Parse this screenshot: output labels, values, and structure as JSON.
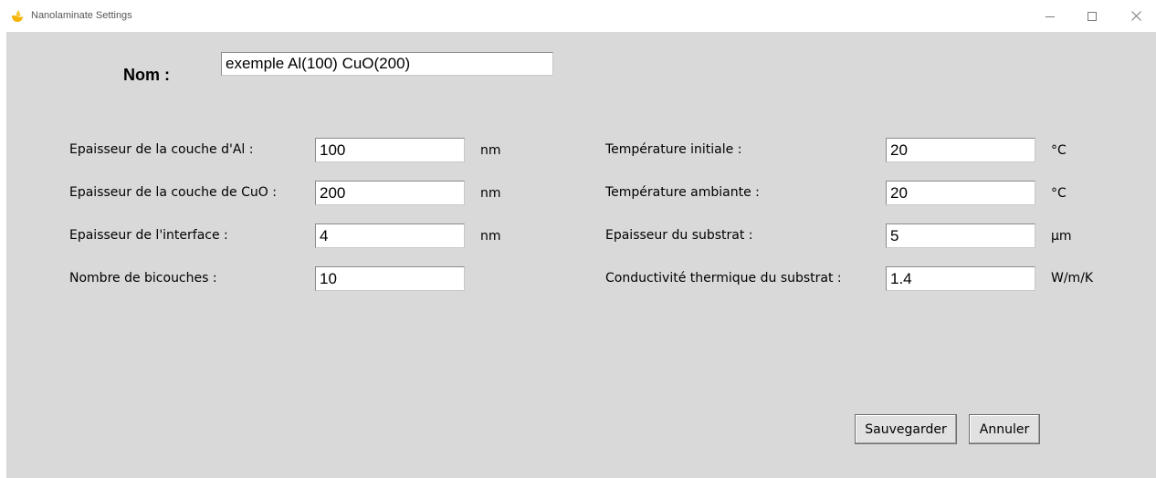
{
  "window": {
    "title": "Nanolaminate Settings",
    "icons": {
      "app": "flame-icon",
      "minimize": "minimize-icon",
      "maximize": "maximize-icon",
      "close": "close-icon"
    }
  },
  "name": {
    "label": "Nom :",
    "value": "exemple Al(100) CuO(200)"
  },
  "left_fields": [
    {
      "label": "Epaisseur de la couche d'Al :",
      "value": "100",
      "unit": "nm"
    },
    {
      "label": "Epaisseur de la couche de CuO :",
      "value": "200",
      "unit": "nm"
    },
    {
      "label": "Epaisseur de l'interface :",
      "value": "4",
      "unit": "nm"
    },
    {
      "label": "Nombre de bicouches :",
      "value": "10",
      "unit": ""
    }
  ],
  "right_fields": [
    {
      "label": "Température initiale :",
      "value": "20",
      "unit": "°C"
    },
    {
      "label": "Température ambiante :",
      "value": "20",
      "unit": "°C"
    },
    {
      "label": "Epaisseur du substrat :",
      "value": "5",
      "unit": "µm"
    },
    {
      "label": "Conductivité thermique du substrat :",
      "value": "1.4",
      "unit": "W/m/K"
    }
  ],
  "buttons": {
    "save": "Sauvegarder",
    "cancel": "Annuler"
  },
  "colors": {
    "client_background": "#d9d9d9",
    "icon_flame": "#f5b400"
  }
}
